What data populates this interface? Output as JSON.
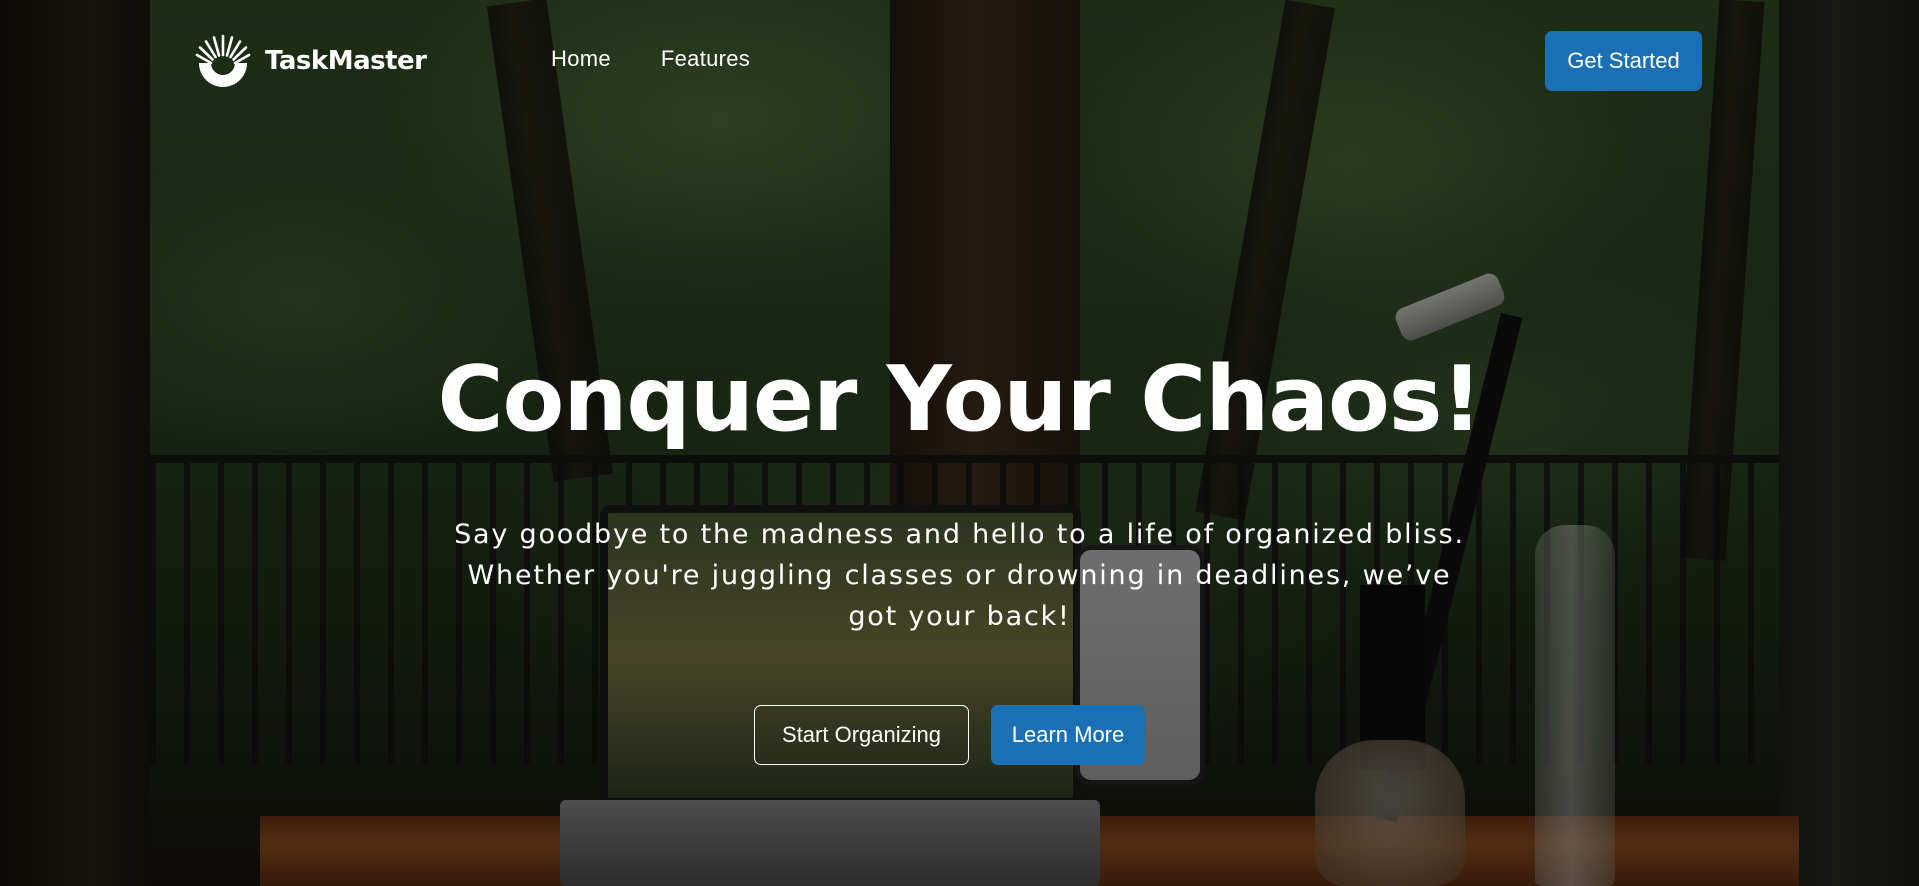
{
  "brand": {
    "name": "TaskMaster",
    "logo_icon": "sunburst-logo-icon"
  },
  "nav": {
    "items": [
      {
        "label": "Home"
      },
      {
        "label": "Features"
      }
    ]
  },
  "header": {
    "cta_label": "Get Started"
  },
  "hero": {
    "title": "Conquer Your Chaos!",
    "subtitle": "Say goodbye to the madness and hello to a life of organized bliss. Whether you're juggling classes or drowning in deadlines, we’ve got your back!",
    "primary_action_label": "Start Organizing",
    "secondary_action_label": "Learn More"
  },
  "colors": {
    "accent": "#1a6fb5",
    "text": "#ffffff",
    "overlay": "rgba(0,0,0,0.5)"
  }
}
